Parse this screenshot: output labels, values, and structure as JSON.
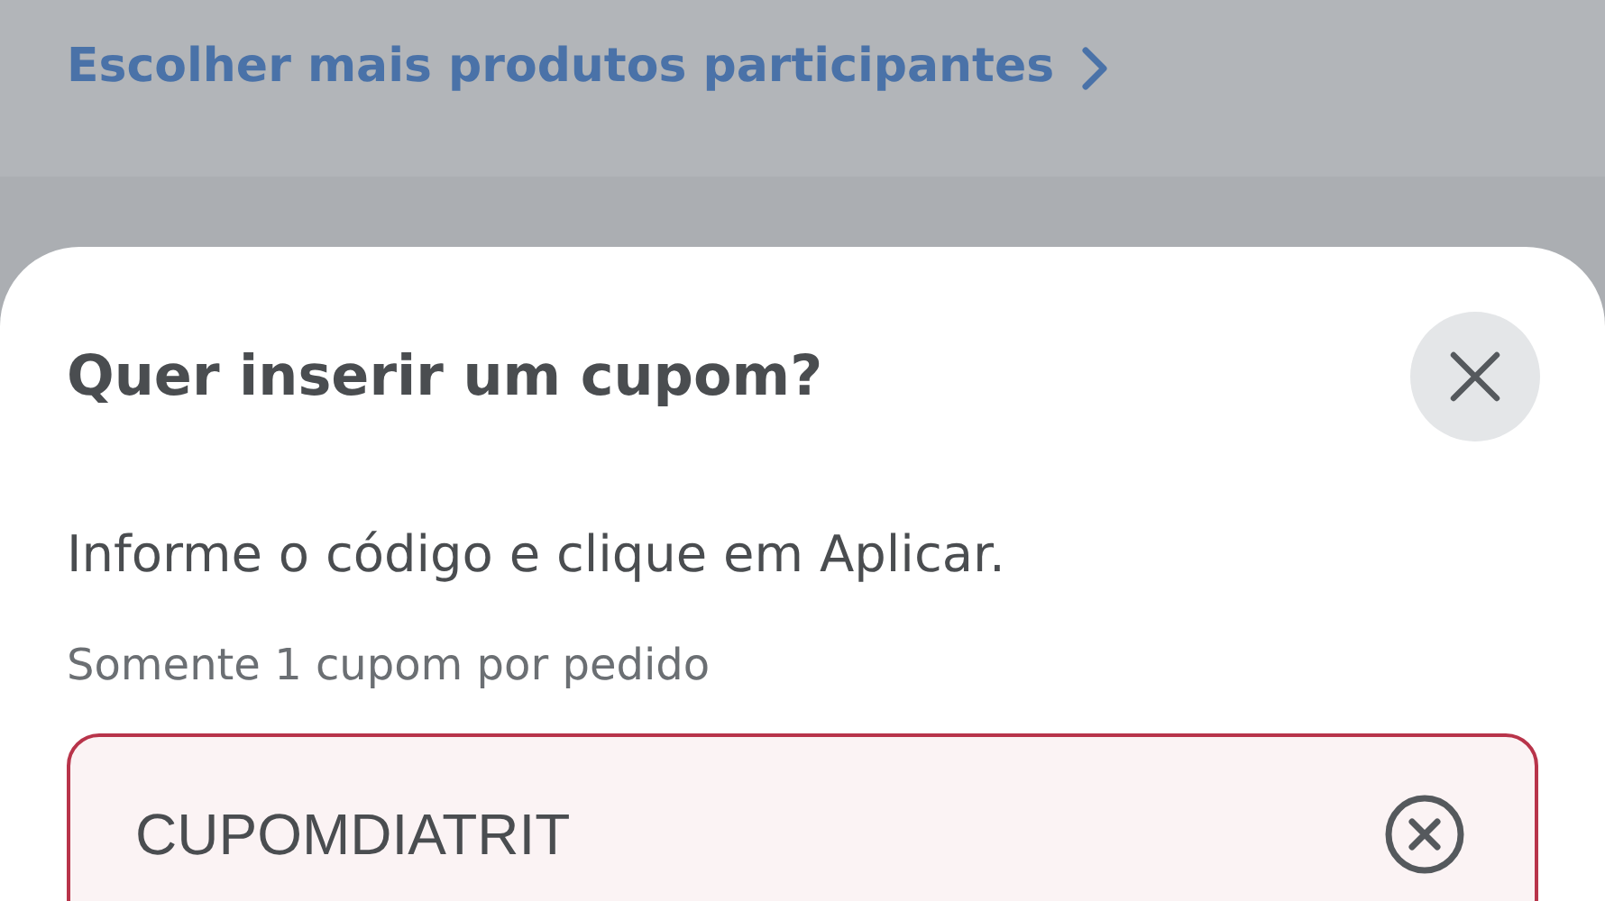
{
  "background_link": {
    "label": "Escolher mais produtos participantes"
  },
  "sheet": {
    "title": "Quer inserir um cupom?",
    "instruction": "Informe o código e clique em Aplicar.",
    "hint": "Somente 1 cupom por pedido",
    "coupon_field": {
      "value": "CUPOMDIATRIT",
      "error": true
    }
  }
}
